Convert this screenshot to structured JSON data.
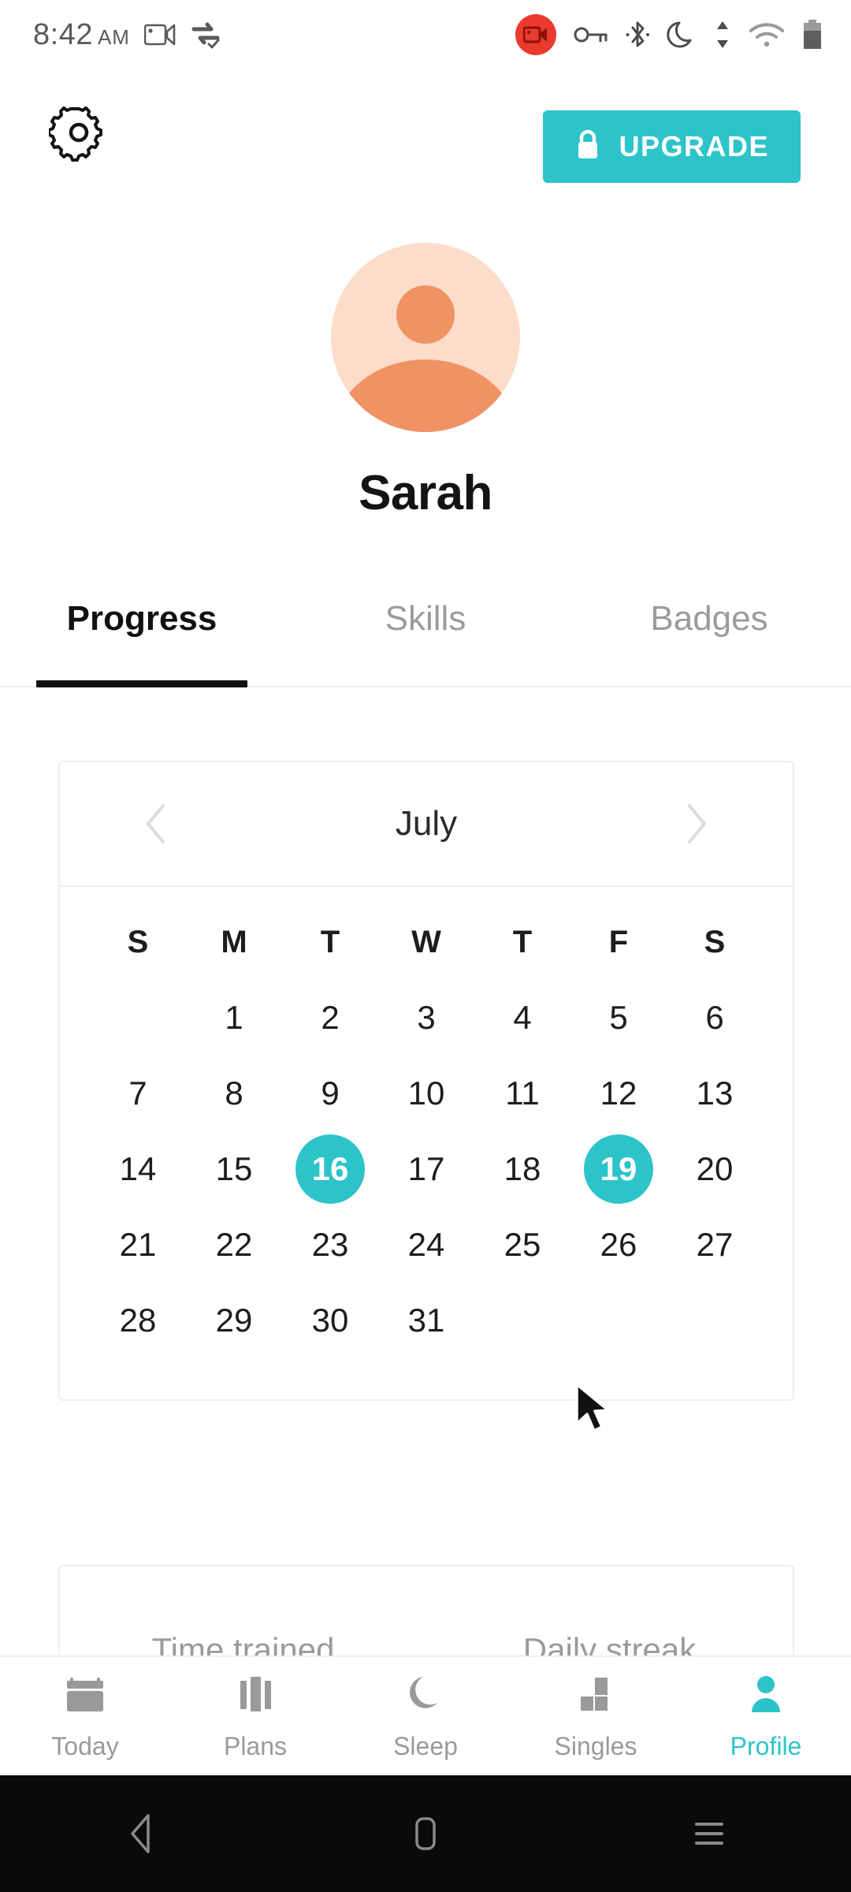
{
  "status_bar": {
    "time": "8:42",
    "ampm": "AM",
    "icons": [
      "screen-cast-icon",
      "data-saver-icon",
      "screen-record-icon",
      "vpn-key-icon",
      "bluetooth-icon",
      "do-not-disturb-icon",
      "data-transfer-icon",
      "wifi-icon",
      "battery-icon"
    ]
  },
  "header": {
    "settings_icon": "gear-icon",
    "upgrade_label": "UPGRADE",
    "upgrade_icon": "lock-icon",
    "accent_color": "#2dc4c9"
  },
  "profile": {
    "avatar_icon": "person-avatar",
    "avatar_bg": "#fbddc9",
    "avatar_fg": "#ef9264",
    "name": "Sarah"
  },
  "tabs": [
    {
      "label": "Progress",
      "active": true
    },
    {
      "label": "Skills",
      "active": false
    },
    {
      "label": "Badges",
      "active": false
    }
  ],
  "calendar": {
    "month": "July",
    "prev_icon": "chevron-left-icon",
    "next_icon": "chevron-right-icon",
    "weekdays": [
      "S",
      "M",
      "T",
      "W",
      "T",
      "F",
      "S"
    ],
    "weeks": [
      [
        "",
        "1",
        "2",
        "3",
        "4",
        "5",
        "6"
      ],
      [
        "7",
        "8",
        "9",
        "10",
        "11",
        "12",
        "13"
      ],
      [
        "14",
        "15",
        "16",
        "17",
        "18",
        "19",
        "20"
      ],
      [
        "21",
        "22",
        "23",
        "24",
        "25",
        "26",
        "27"
      ],
      [
        "28",
        "29",
        "30",
        "31",
        "",
        "",
        ""
      ]
    ],
    "selected_days": [
      "16",
      "19"
    ],
    "selected_color": "#2dc4c9"
  },
  "stats": [
    {
      "label": "Time trained"
    },
    {
      "label": "Daily streak"
    }
  ],
  "bottom_nav": [
    {
      "label": "Today",
      "icon": "calendar-icon",
      "active": false
    },
    {
      "label": "Plans",
      "icon": "bars-icon",
      "active": false
    },
    {
      "label": "Sleep",
      "icon": "moon-icon",
      "active": false
    },
    {
      "label": "Singles",
      "icon": "blocks-icon",
      "active": false
    },
    {
      "label": "Profile",
      "icon": "person-icon",
      "active": true
    }
  ],
  "android_nav": [
    {
      "icon": "back-icon"
    },
    {
      "icon": "home-icon"
    },
    {
      "icon": "recents-icon"
    }
  ]
}
